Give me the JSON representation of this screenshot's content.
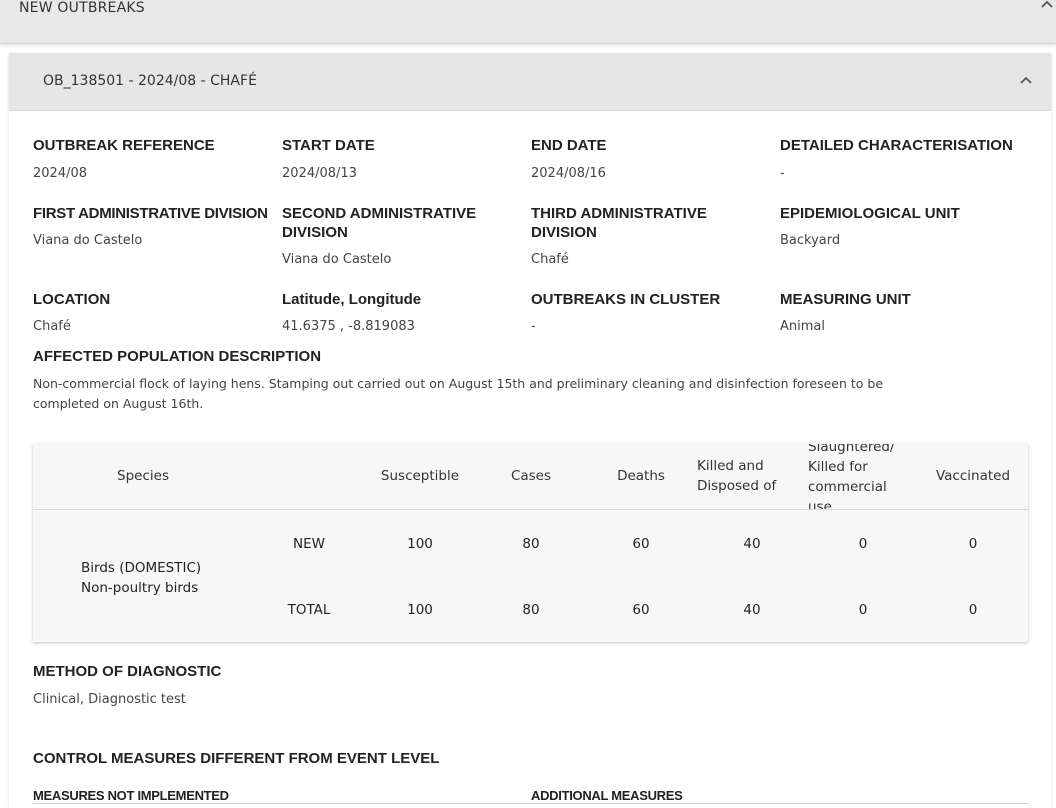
{
  "top_panel": {
    "title": "NEW OUTBREAKS"
  },
  "outbreak_panel": {
    "title": "OB_138501 - 2024/08 - CHAFÉ"
  },
  "fields": {
    "outbreak_reference": {
      "label": "OUTBREAK REFERENCE",
      "value": "2024/08"
    },
    "start_date": {
      "label": "START DATE",
      "value": "2024/08/13"
    },
    "end_date": {
      "label": "END DATE",
      "value": "2024/08/16"
    },
    "detailed_characterisation": {
      "label": "DETAILED CHARACTERISATION",
      "value": "-"
    },
    "first_admin_division": {
      "label": "FIRST ADMINISTRATIVE DIVISION",
      "value": "Viana do Castelo"
    },
    "second_admin_division": {
      "label_line1": "SECOND ADMINISTRATIVE",
      "label_line2": "DIVISION",
      "value": "Viana do Castelo"
    },
    "third_admin_division": {
      "label_line1": "THIRD ADMINISTRATIVE",
      "label_line2": "DIVISION",
      "value": "Chafé"
    },
    "epidemiological_unit": {
      "label": "EPIDEMIOLOGICAL UNIT",
      "value": "Backyard"
    },
    "location": {
      "label": "LOCATION",
      "value": "Chafé"
    },
    "lat_long": {
      "label": "Latitude, Longitude",
      "value": "41.6375 , -8.819083"
    },
    "outbreaks_in_cluster": {
      "label": "OUTBREAKS IN CLUSTER",
      "value": "-"
    },
    "measuring_unit": {
      "label": "MEASURING UNIT",
      "value": "Animal"
    },
    "affected_population": {
      "label": "AFFECTED POPULATION DESCRIPTION",
      "value_line1": "Non-commercial flock of laying hens. Stamping out carried out on August 15th and preliminary cleaning and disinfection foreseen to be",
      "value_line2": "completed on August 16th."
    }
  },
  "table": {
    "headers": {
      "species": "Species",
      "susceptible": "Susceptible",
      "cases": "Cases",
      "deaths": "Deaths",
      "killed_line1": "Killed and",
      "killed_line2": "Disposed of",
      "slaughtered_line1": "Slaughtered/",
      "slaughtered_line2": "Killed for",
      "slaughtered_line3": "commercial",
      "slaughtered_line4": "use",
      "vaccinated": "Vaccinated"
    },
    "species_line1": "Birds (DOMESTIC)",
    "species_line2": "Non-poultry birds",
    "rows": [
      {
        "type": "NEW",
        "susceptible": "100",
        "cases": "80",
        "deaths": "60",
        "killed": "40",
        "slaughtered": "0",
        "vaccinated": "0"
      },
      {
        "type": "TOTAL",
        "susceptible": "100",
        "cases": "80",
        "deaths": "60",
        "killed": "40",
        "slaughtered": "0",
        "vaccinated": "0"
      }
    ]
  },
  "method_of_diagnostic": {
    "label": "METHOD OF DIAGNOSTIC",
    "value": "Clinical, Diagnostic test"
  },
  "control_measures": {
    "title": "CONTROL MEASURES DIFFERENT FROM EVENT LEVEL",
    "not_implemented": "MEASURES NOT IMPLEMENTED",
    "additional": "ADDITIONAL MEASURES"
  },
  "icons": {
    "collapse": "chevron-up-icon"
  }
}
